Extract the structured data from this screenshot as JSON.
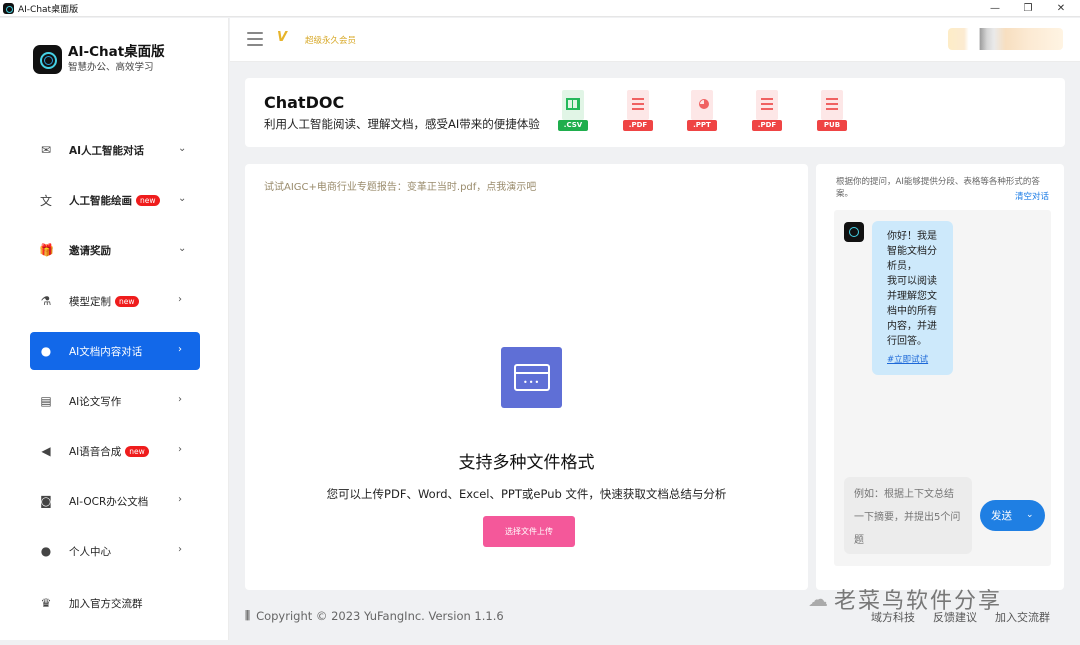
{
  "window": {
    "title": "AI-Chat桌面版"
  },
  "brand": {
    "name": "AI-Chat桌面版",
    "tagline": "智慧办公、高效学习"
  },
  "sidebar": {
    "items": [
      {
        "label": "AI人工智能对话",
        "icon": "mail-icon",
        "chevron": "⌄"
      },
      {
        "label": "人工智能绘画",
        "icon": "translate-icon",
        "chevron": "⌄",
        "badge": "new"
      },
      {
        "label": "邀请奖励",
        "icon": "gift-icon",
        "chevron": "⌄"
      },
      {
        "label": "模型定制",
        "icon": "flask-icon",
        "chevron": "›",
        "badge": "new"
      },
      {
        "label": "AI文档内容对话",
        "icon": "globe-icon",
        "chevron": "›",
        "active": true
      },
      {
        "label": "AI论文写作",
        "icon": "document-icon",
        "chevron": "›"
      },
      {
        "label": "AI语音合成",
        "icon": "speaker-icon",
        "chevron": "›",
        "badge": "new"
      },
      {
        "label": "AI-OCR办公文档",
        "icon": "camera-icon",
        "chevron": "›"
      },
      {
        "label": "个人中心",
        "icon": "person-icon",
        "chevron": "›"
      },
      {
        "label": "加入官方交流群",
        "icon": "crown-icon"
      }
    ]
  },
  "header": {
    "vip_label": "超级永久会员"
  },
  "banner": {
    "title": "ChatDOC",
    "subtitle": "利用人工智能阅读、理解文档，感受AI带来的便捷体验",
    "file_types": [
      ".CSV",
      ".PDF",
      ".PPT",
      ".PDF",
      "PUB"
    ]
  },
  "main": {
    "demo_link": "试试AIGC+电商行业专题报告：变革正当时.pdf，点我演示吧",
    "title": "支持多种文件格式",
    "subtitle": "您可以上传PDF、Word、Excel、PPT或ePub 文件，快速获取文档总结与分析",
    "upload_label": "选择文件上传"
  },
  "chat": {
    "info": "根据你的提问，AI能够提供分段、表格等各种形式的答案。",
    "clear_label": "清空对话",
    "greeting_lines": [
      "你好！我是智能文档分析员，",
      "我可以阅读并理解您文档中的所有内容，并进行回答。"
    ],
    "try_link": "#立即试试",
    "input_placeholder": "例如：根据上下文总结一下摘要，并提出5个问题",
    "send_label": "发送"
  },
  "footer": {
    "copyright": "Copyright © 2023 YuFangInc. Version 1.1.6",
    "watermark": "老菜鸟软件分享",
    "links": [
      "域方科技",
      "反馈建议",
      "加入交流群"
    ]
  }
}
